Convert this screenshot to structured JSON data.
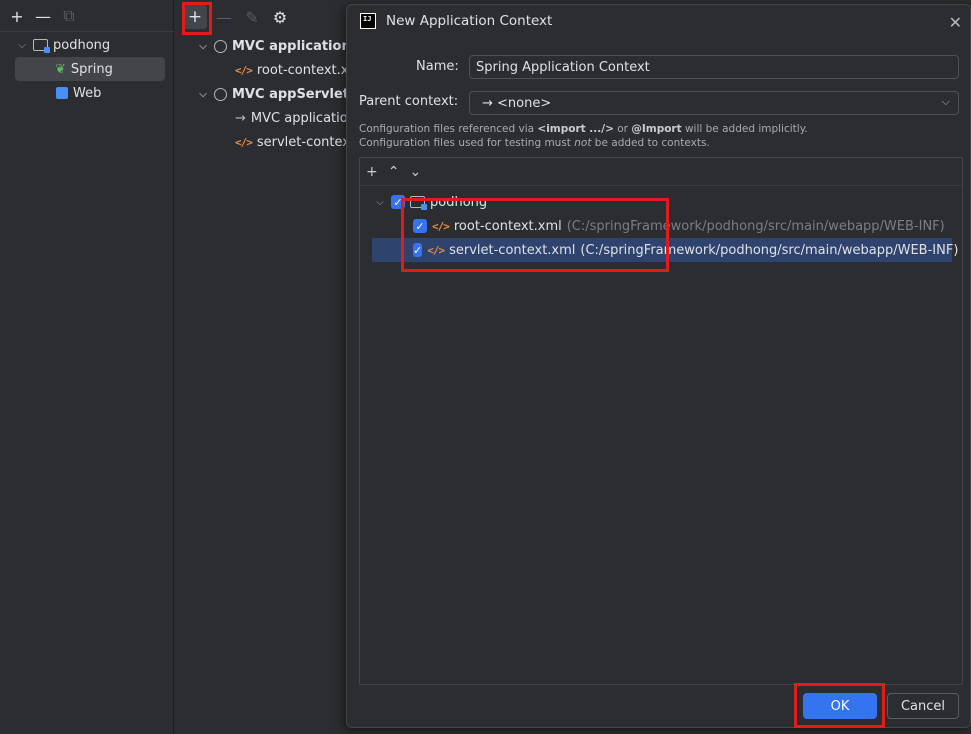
{
  "left_panel": {
    "toolbar": {
      "add": "+",
      "remove": "—",
      "copy": "⧉"
    },
    "tree": [
      {
        "label": "podhong",
        "icon": "module-icon"
      },
      {
        "label": "Spring",
        "icon": "spring-leaf-icon"
      },
      {
        "label": "Web",
        "icon": "web-facet-icon"
      }
    ]
  },
  "mid_panel": {
    "toolbar": {
      "add": "+",
      "remove": "—",
      "edit": "✎",
      "settings": "⚙"
    },
    "items": [
      {
        "label": "MVC application c"
      },
      {
        "label": "root-context.x"
      },
      {
        "label": "MVC appServlet s"
      },
      {
        "label": "MVC applicatio"
      },
      {
        "label": "servlet-contex"
      }
    ]
  },
  "dialog": {
    "title": "New Application Context",
    "logo_text": "IJ",
    "name_label": "Name:",
    "name_value": "Spring Application Context",
    "parent_label": "Parent context:",
    "parent_value": "→ <none>",
    "hint1_pre": "Configuration files referenced via ",
    "hint1_import": "<import .../>",
    "hint1_mid": " or ",
    "hint1_at": "@Import",
    "hint1_post": " will be added implicitly.",
    "hint2_pre": "Configuration files used for testing must ",
    "hint2_not": "not",
    "hint2_post": " be added to contexts.",
    "files": {
      "module": "podhong",
      "rows": [
        {
          "name": "root-context.xml",
          "path": "(C:/springFramework/podhong/src/main/webapp/WEB-INF)"
        },
        {
          "name": "servlet-context.xml",
          "path": "(C:/springFramework/podhong/src/main/webapp/WEB-INF)"
        }
      ]
    },
    "ok": "OK",
    "cancel": "Cancel"
  },
  "colors": {
    "accent": "#3574f0",
    "highlight": "#e31b1b",
    "selection": "#2e436e"
  }
}
